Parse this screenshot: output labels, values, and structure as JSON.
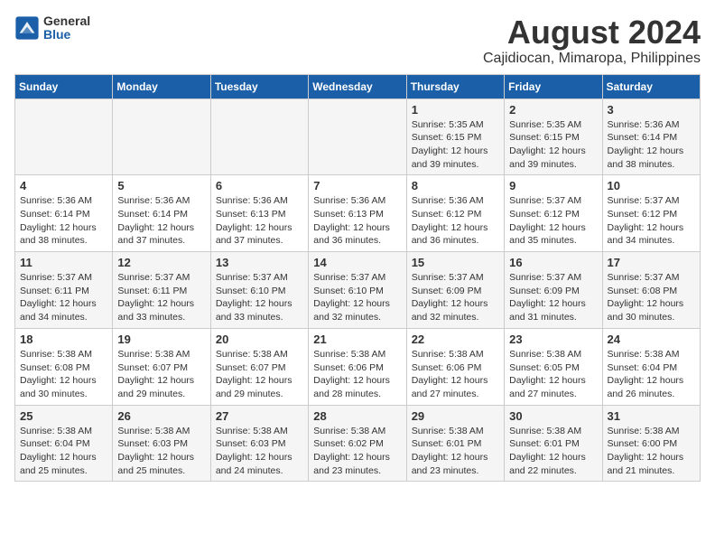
{
  "logo": {
    "line1": "General",
    "line2": "Blue"
  },
  "title": "August 2024",
  "subtitle": "Cajidiocan, Mimaropa, Philippines",
  "days_of_week": [
    "Sunday",
    "Monday",
    "Tuesday",
    "Wednesday",
    "Thursday",
    "Friday",
    "Saturday"
  ],
  "weeks": [
    [
      {
        "day": "",
        "info": ""
      },
      {
        "day": "",
        "info": ""
      },
      {
        "day": "",
        "info": ""
      },
      {
        "day": "",
        "info": ""
      },
      {
        "day": "1",
        "info": "Sunrise: 5:35 AM\nSunset: 6:15 PM\nDaylight: 12 hours\nand 39 minutes."
      },
      {
        "day": "2",
        "info": "Sunrise: 5:35 AM\nSunset: 6:15 PM\nDaylight: 12 hours\nand 39 minutes."
      },
      {
        "day": "3",
        "info": "Sunrise: 5:36 AM\nSunset: 6:14 PM\nDaylight: 12 hours\nand 38 minutes."
      }
    ],
    [
      {
        "day": "4",
        "info": "Sunrise: 5:36 AM\nSunset: 6:14 PM\nDaylight: 12 hours\nand 38 minutes."
      },
      {
        "day": "5",
        "info": "Sunrise: 5:36 AM\nSunset: 6:14 PM\nDaylight: 12 hours\nand 37 minutes."
      },
      {
        "day": "6",
        "info": "Sunrise: 5:36 AM\nSunset: 6:13 PM\nDaylight: 12 hours\nand 37 minutes."
      },
      {
        "day": "7",
        "info": "Sunrise: 5:36 AM\nSunset: 6:13 PM\nDaylight: 12 hours\nand 36 minutes."
      },
      {
        "day": "8",
        "info": "Sunrise: 5:36 AM\nSunset: 6:12 PM\nDaylight: 12 hours\nand 36 minutes."
      },
      {
        "day": "9",
        "info": "Sunrise: 5:37 AM\nSunset: 6:12 PM\nDaylight: 12 hours\nand 35 minutes."
      },
      {
        "day": "10",
        "info": "Sunrise: 5:37 AM\nSunset: 6:12 PM\nDaylight: 12 hours\nand 34 minutes."
      }
    ],
    [
      {
        "day": "11",
        "info": "Sunrise: 5:37 AM\nSunset: 6:11 PM\nDaylight: 12 hours\nand 34 minutes."
      },
      {
        "day": "12",
        "info": "Sunrise: 5:37 AM\nSunset: 6:11 PM\nDaylight: 12 hours\nand 33 minutes."
      },
      {
        "day": "13",
        "info": "Sunrise: 5:37 AM\nSunset: 6:10 PM\nDaylight: 12 hours\nand 33 minutes."
      },
      {
        "day": "14",
        "info": "Sunrise: 5:37 AM\nSunset: 6:10 PM\nDaylight: 12 hours\nand 32 minutes."
      },
      {
        "day": "15",
        "info": "Sunrise: 5:37 AM\nSunset: 6:09 PM\nDaylight: 12 hours\nand 32 minutes."
      },
      {
        "day": "16",
        "info": "Sunrise: 5:37 AM\nSunset: 6:09 PM\nDaylight: 12 hours\nand 31 minutes."
      },
      {
        "day": "17",
        "info": "Sunrise: 5:37 AM\nSunset: 6:08 PM\nDaylight: 12 hours\nand 30 minutes."
      }
    ],
    [
      {
        "day": "18",
        "info": "Sunrise: 5:38 AM\nSunset: 6:08 PM\nDaylight: 12 hours\nand 30 minutes."
      },
      {
        "day": "19",
        "info": "Sunrise: 5:38 AM\nSunset: 6:07 PM\nDaylight: 12 hours\nand 29 minutes."
      },
      {
        "day": "20",
        "info": "Sunrise: 5:38 AM\nSunset: 6:07 PM\nDaylight: 12 hours\nand 29 minutes."
      },
      {
        "day": "21",
        "info": "Sunrise: 5:38 AM\nSunset: 6:06 PM\nDaylight: 12 hours\nand 28 minutes."
      },
      {
        "day": "22",
        "info": "Sunrise: 5:38 AM\nSunset: 6:06 PM\nDaylight: 12 hours\nand 27 minutes."
      },
      {
        "day": "23",
        "info": "Sunrise: 5:38 AM\nSunset: 6:05 PM\nDaylight: 12 hours\nand 27 minutes."
      },
      {
        "day": "24",
        "info": "Sunrise: 5:38 AM\nSunset: 6:04 PM\nDaylight: 12 hours\nand 26 minutes."
      }
    ],
    [
      {
        "day": "25",
        "info": "Sunrise: 5:38 AM\nSunset: 6:04 PM\nDaylight: 12 hours\nand 25 minutes."
      },
      {
        "day": "26",
        "info": "Sunrise: 5:38 AM\nSunset: 6:03 PM\nDaylight: 12 hours\nand 25 minutes."
      },
      {
        "day": "27",
        "info": "Sunrise: 5:38 AM\nSunset: 6:03 PM\nDaylight: 12 hours\nand 24 minutes."
      },
      {
        "day": "28",
        "info": "Sunrise: 5:38 AM\nSunset: 6:02 PM\nDaylight: 12 hours\nand 23 minutes."
      },
      {
        "day": "29",
        "info": "Sunrise: 5:38 AM\nSunset: 6:01 PM\nDaylight: 12 hours\nand 23 minutes."
      },
      {
        "day": "30",
        "info": "Sunrise: 5:38 AM\nSunset: 6:01 PM\nDaylight: 12 hours\nand 22 minutes."
      },
      {
        "day": "31",
        "info": "Sunrise: 5:38 AM\nSunset: 6:00 PM\nDaylight: 12 hours\nand 21 minutes."
      }
    ]
  ]
}
